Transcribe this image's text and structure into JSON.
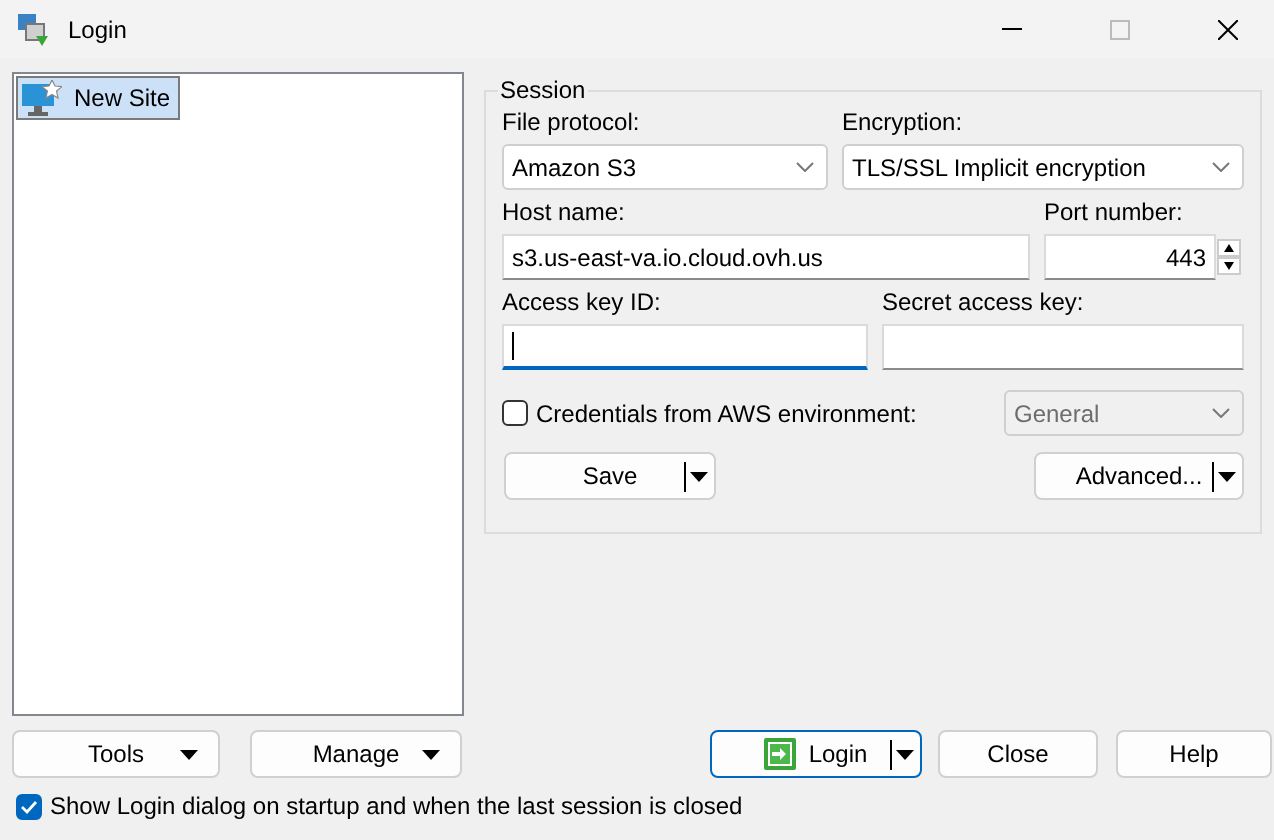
{
  "window": {
    "title": "Login"
  },
  "sites": [
    {
      "label": "New Site",
      "selected": true
    }
  ],
  "session": {
    "title": "Session",
    "file_protocol": {
      "label": "File protocol:",
      "value": "Amazon S3"
    },
    "encryption": {
      "label": "Encryption:",
      "value": "TLS/SSL Implicit encryption"
    },
    "host_name": {
      "label": "Host name:",
      "value": "s3.us-east-va.io.cloud.ovh.us"
    },
    "port_number": {
      "label": "Port number:",
      "value": "443"
    },
    "access_key_id": {
      "label": "Access key ID:",
      "focused": true
    },
    "secret_access_key": {
      "label": "Secret access key:",
      "focused": false
    },
    "aws_credentials": {
      "label": "Credentials from AWS environment:",
      "checked": false
    },
    "aws_profile": {
      "value": "General",
      "disabled": true
    },
    "buttons": [
      {
        "label": "Save",
        "kind": "split"
      },
      {
        "label": "Advanced...",
        "kind": "split"
      }
    ]
  },
  "bottom_buttons": [
    {
      "label": "Tools",
      "kind": "menu",
      "default": false
    },
    {
      "label": "Manage",
      "kind": "menu",
      "default": false
    },
    {
      "label": "Login",
      "kind": "split",
      "default": true,
      "icon": true
    },
    {
      "label": "Close",
      "kind": "plain",
      "default": false
    },
    {
      "label": "Help",
      "kind": "plain",
      "default": false
    }
  ],
  "show_login": {
    "label": "Show Login dialog on startup and when the last session is closed",
    "checked": true
  }
}
